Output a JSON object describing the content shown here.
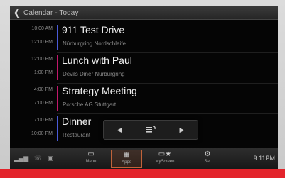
{
  "header": {
    "back_icon": "chevron-left-icon",
    "title": "Calendar - Today"
  },
  "events": [
    {
      "start": "10:00 AM",
      "end": "12:00 PM",
      "title": "911 Test Drive",
      "location": "Nürburgring Nordschleife",
      "color": "#4a5bd8"
    },
    {
      "start": "12:00 PM",
      "end": "1:00 PM",
      "title": "Lunch with Paul",
      "location": "Devils Diner Nürburgring",
      "color": "#c2186b"
    },
    {
      "start": "4:00 PM",
      "end": "7:00 PM",
      "title": "Strategy Meeting",
      "location": "Porsche AG Stuttgart",
      "color": "#c2186b"
    },
    {
      "start": "7:00 PM",
      "end": "10:00 PM",
      "title": "Dinner",
      "location": "Restaurant",
      "color": "#4a5bd8"
    }
  ],
  "popup": {
    "prev_icon": "arrow-left-icon",
    "mode_icon": "menu-icon",
    "next_icon": "arrow-right-icon"
  },
  "bottombar": {
    "status_icons": [
      "signal-icon",
      "phone-icon",
      "device-icon"
    ],
    "tabs": [
      {
        "label": "Menu",
        "icon": "car-icon"
      },
      {
        "label": "Apps",
        "icon": "grid-icon",
        "active": true
      },
      {
        "label": "MyScreen",
        "icon": "star-screen-icon"
      },
      {
        "label": "Set",
        "icon": "settings-icon"
      }
    ],
    "clock": "9:11PM"
  },
  "colors": {
    "accent_red": "#e3242b",
    "active_tab": "#c0633a"
  }
}
